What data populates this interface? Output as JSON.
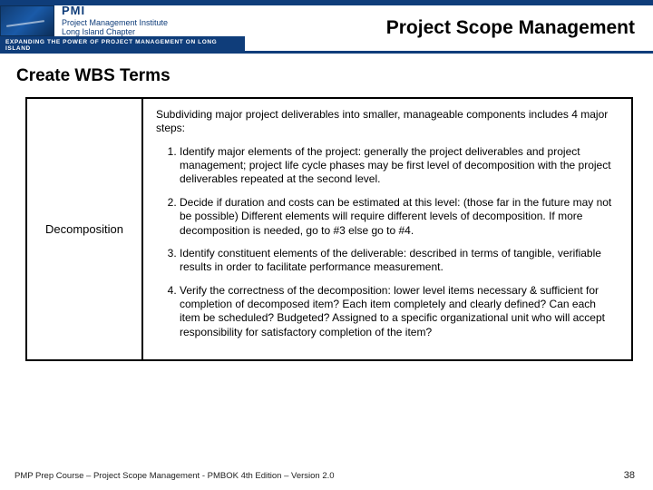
{
  "header": {
    "org_abbrev": "PMI",
    "org_line1": "Project Management Institute",
    "org_line2": "Long Island Chapter",
    "tagline": "EXPANDING THE POWER OF PROJECT MANAGEMENT ON LONG ISLAND",
    "page_title": "Project Scope Management"
  },
  "subtitle": "Create WBS Terms",
  "term": {
    "name": "Decomposition",
    "intro": "Subdividing major project deliverables into smaller, manageable components includes 4 major steps:",
    "steps": [
      "Identify major elements of the project: generally the project deliverables and project management; project life cycle phases may be first level of decomposition with the project deliverables repeated at the second level.",
      "Decide if duration and costs can be estimated at this level: (those far in the future may not be possible) Different elements will require different levels of decomposition. If more decomposition is needed, go to #3 else go to #4.",
      "Identify constituent elements of the deliverable: described in terms of tangible, verifiable results in order to facilitate performance measurement.",
      "Verify the correctness of the decomposition: lower level items necessary & sufficient for completion of decomposed item? Each item completely and clearly defined? Can each item be scheduled? Budgeted? Assigned to a specific organizational unit who will accept responsibility for satisfactory completion of the item?"
    ]
  },
  "footer": "PMP Prep Course – Project Scope Management - PMBOK 4th Edition – Version 2.0",
  "page_number": "38"
}
